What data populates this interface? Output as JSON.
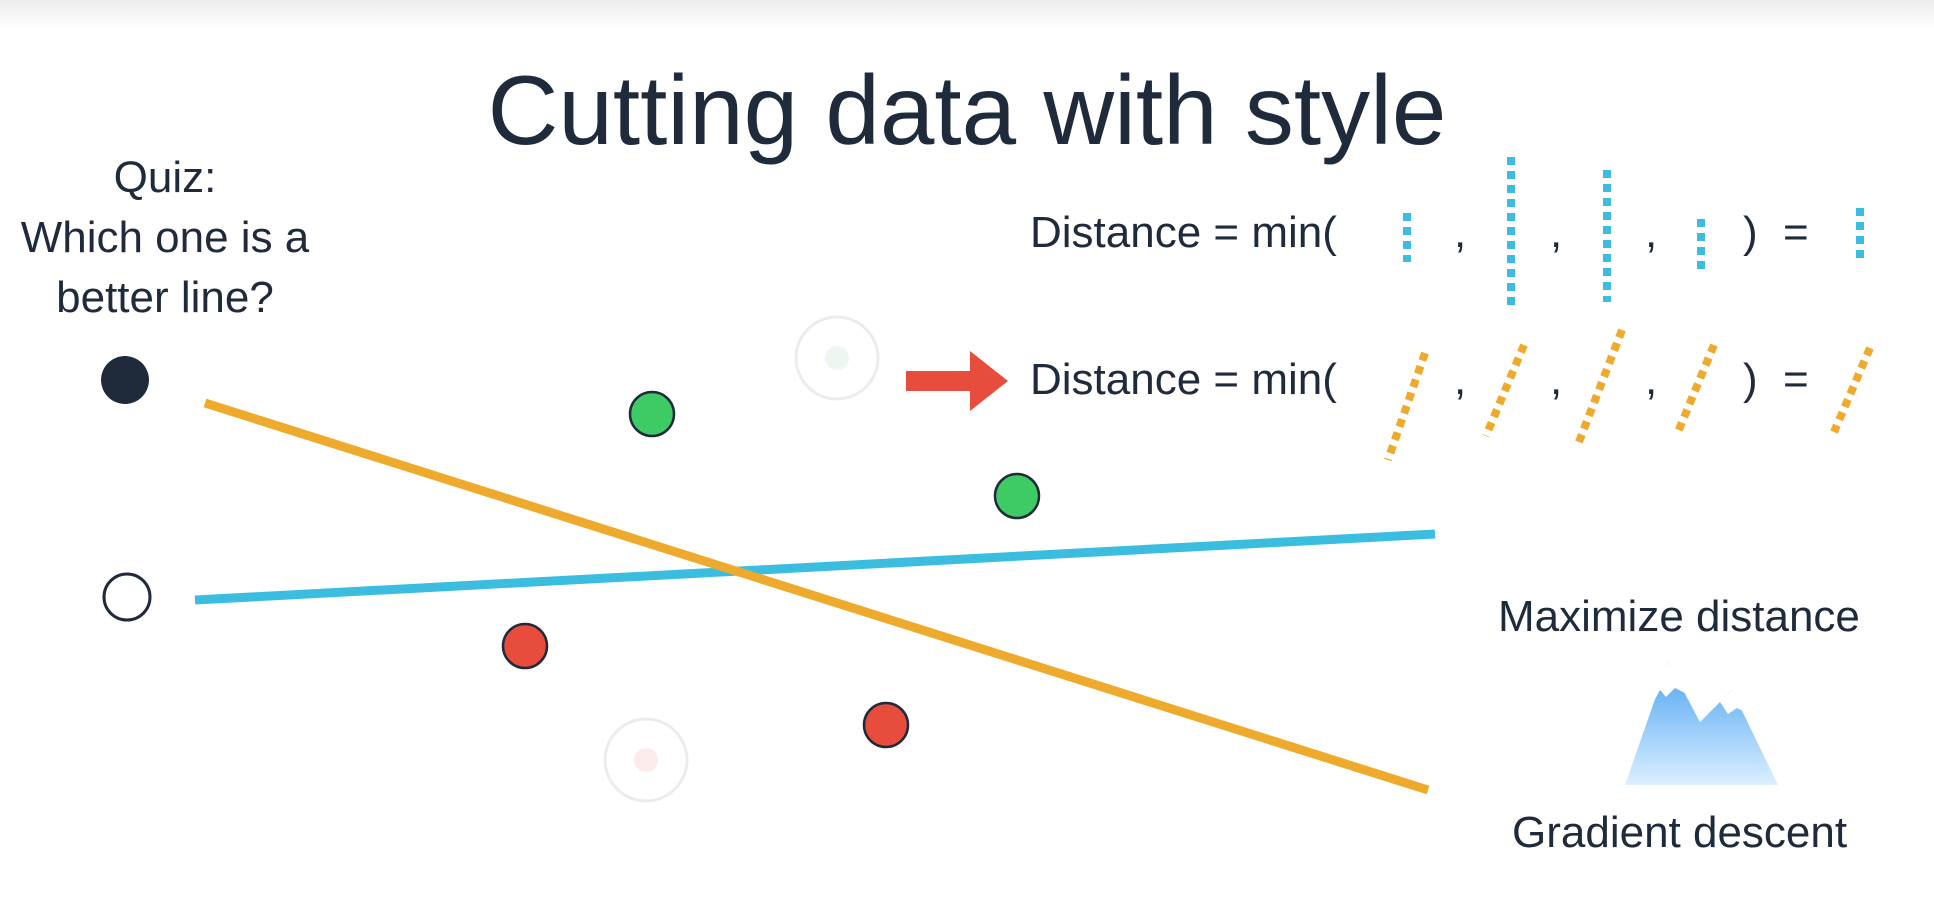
{
  "title": "Cutting data with style",
  "quiz": {
    "line1": "Quiz:",
    "line2": "Which one is a",
    "line3": "better line?"
  },
  "formula": {
    "prefix": "Distance = min(",
    "separator": ",",
    "close": ")",
    "equals": "="
  },
  "side": {
    "top_label": "Maximize distance",
    "bottom_label": "Gradient descent"
  },
  "colors": {
    "text": "#1f2b3a",
    "blue_line": "#3bbde0",
    "orange_line": "#eeaa2c",
    "green_point": "#3ecb63",
    "red_point": "#e74c3c",
    "dark_point": "#1f2b3a",
    "arrow": "#e74c3c"
  },
  "icons": {
    "arrow": "right-arrow-icon",
    "mountain": "mountain-icon"
  }
}
